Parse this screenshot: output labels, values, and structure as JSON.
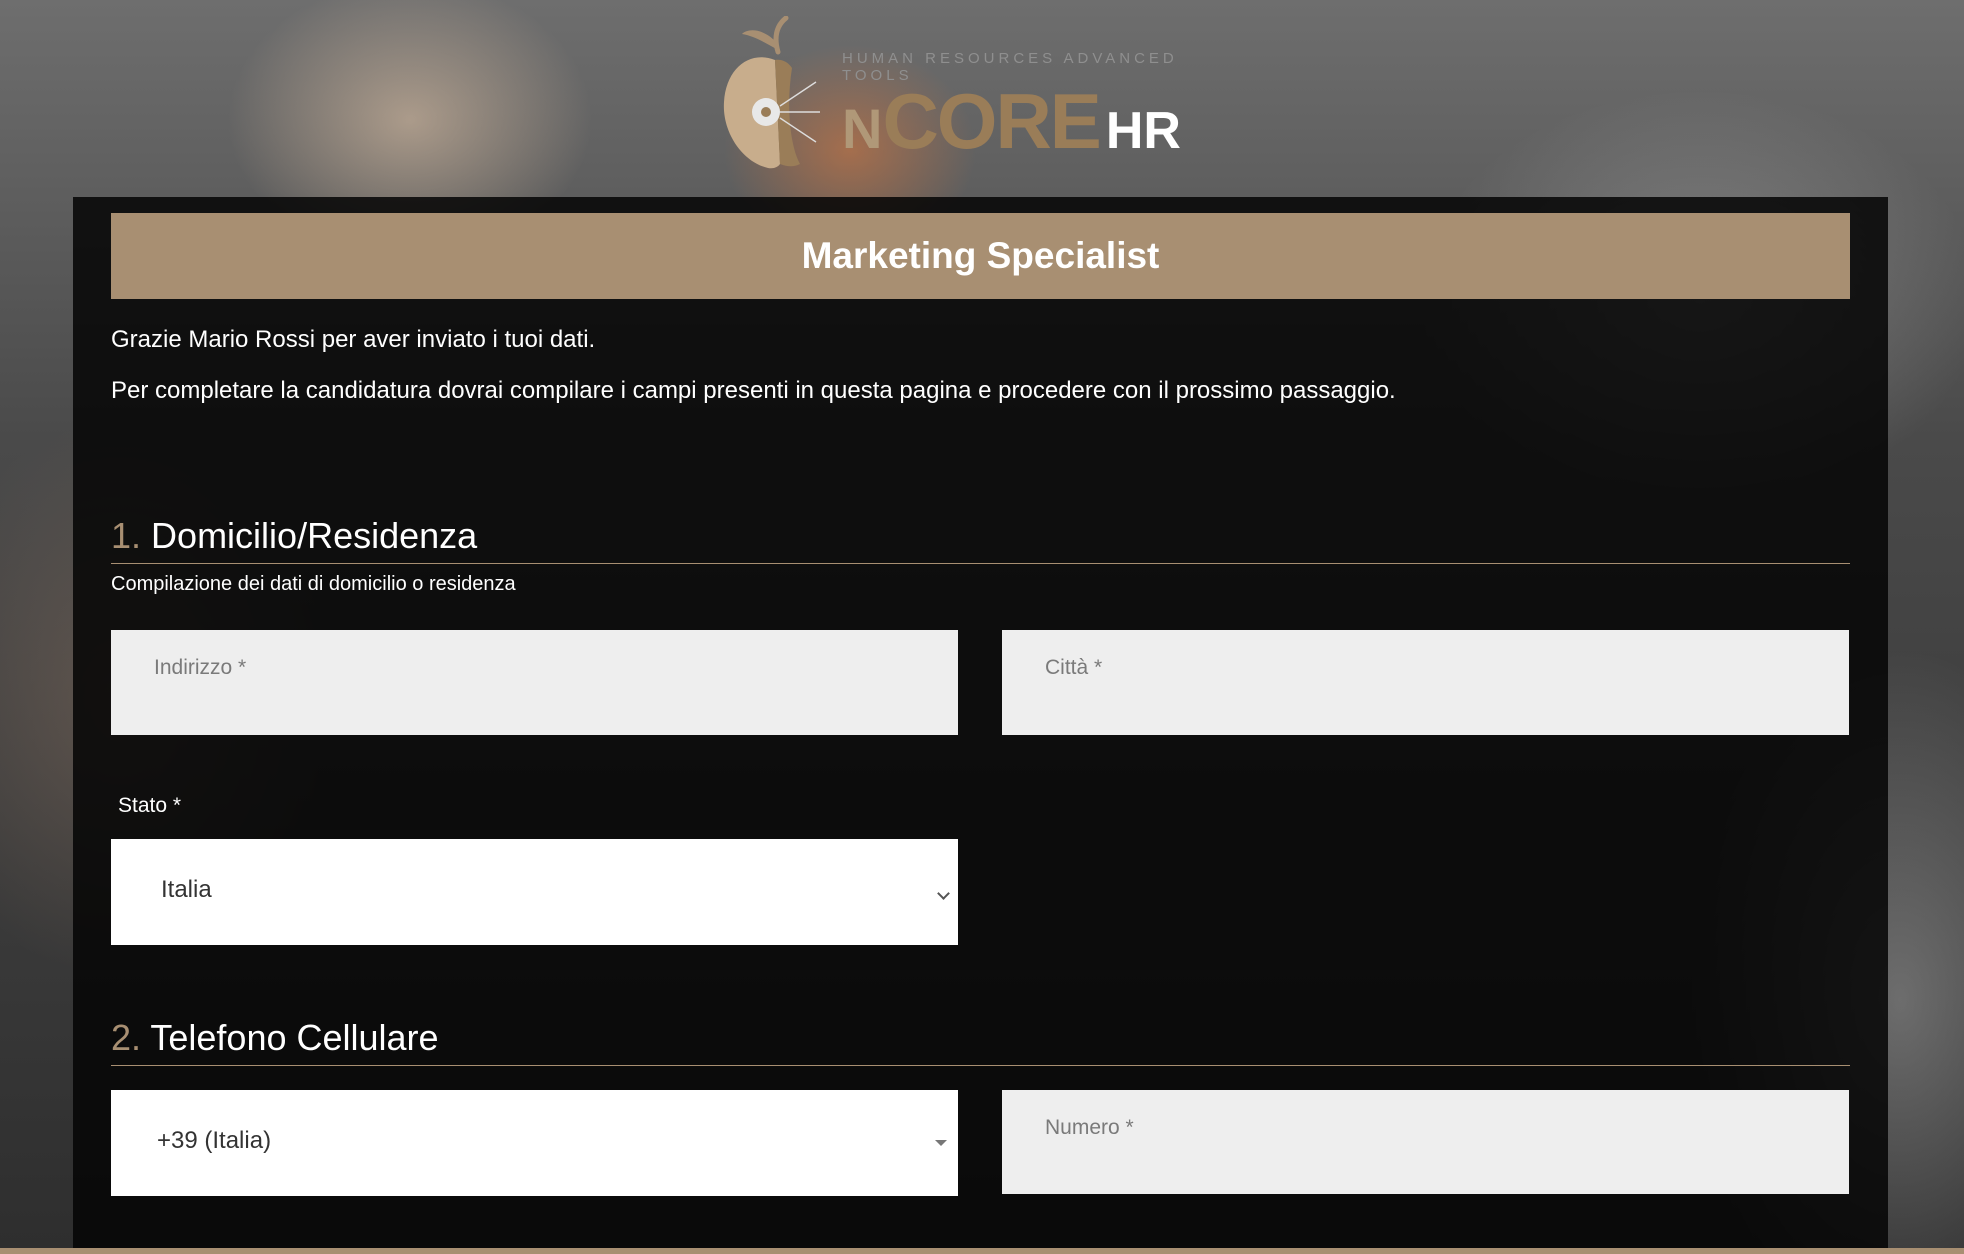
{
  "logo": {
    "tagline": "HUMAN RESOURCES ADVANCED TOOLS",
    "brand_n": "N",
    "brand_core": "CORE",
    "brand_hr": "HR"
  },
  "header": {
    "title": "Marketing Specialist"
  },
  "intro": {
    "line1": "Grazie Mario Rossi per aver inviato i tuoi dati.",
    "line2": "Per completare la candidatura dovrai compilare i campi presenti in questa pagina e procedere con il prossimo passaggio."
  },
  "section1": {
    "number": "1.",
    "title": "Domicilio/Residenza",
    "subtitle": "Compilazione dei dati di domicilio o residenza",
    "address_placeholder": "Indirizzo *",
    "city_placeholder": "Città *",
    "country_label": "Stato *",
    "country_value": "Italia"
  },
  "section2": {
    "number": "2.",
    "title": "Telefono Cellulare",
    "prefix_value": "+39 (Italia)",
    "number_placeholder": "Numero *"
  },
  "colors": {
    "accent": "#a88f72",
    "panel": "#050505",
    "field_bg": "#eeeeee"
  }
}
